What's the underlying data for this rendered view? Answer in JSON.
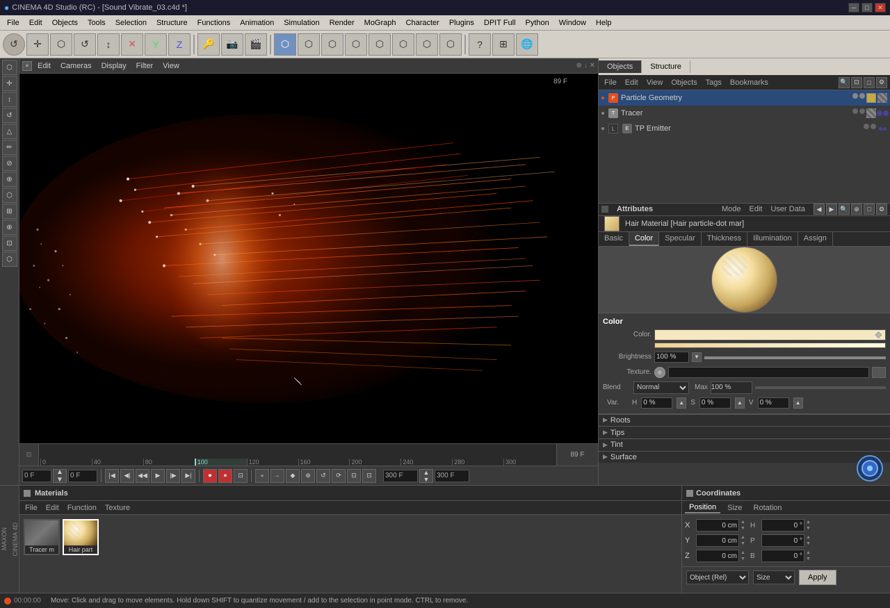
{
  "titleBar": {
    "title": "CINEMA 4D Studio (RC) - [Sound Vibrate_03.c4d *]",
    "winBtns": [
      "─",
      "□",
      "✕"
    ]
  },
  "menuBar": {
    "items": [
      "File",
      "Edit",
      "Objects",
      "Tools",
      "Selection",
      "Structure",
      "Functions",
      "Animation",
      "Simulation",
      "Render",
      "MoGraph",
      "Character",
      "Plugins",
      "DPIT Full",
      "Python",
      "Window",
      "Help"
    ]
  },
  "toolbar": {
    "buttons": [
      "⬤",
      "✛",
      "⬡",
      "↺",
      "↕",
      "✕",
      "Y",
      "Z",
      "→",
      "🎬",
      "📷",
      "🎞",
      "⬡",
      "⬡",
      "⬡",
      "⬡",
      "⬡",
      "⬡",
      "⬡",
      "⬡",
      "⬡",
      "?",
      "⬡",
      "🌐"
    ]
  },
  "viewport": {
    "menuItems": [
      "Edit",
      "Cameras",
      "Display",
      "Filter",
      "View"
    ],
    "frameInfo": "89 F",
    "cursorPos": "~385, ~360"
  },
  "timeline": {
    "marks": [
      "0",
      "40",
      "80",
      "100",
      "120",
      "160",
      "200",
      "240",
      "280",
      "300"
    ],
    "playhead": "100",
    "currentFrame": "0 F",
    "startFrame": "0 F",
    "endFrame": "300 F",
    "previewEnd": "300 F"
  },
  "transport": {
    "currentFrame": "0 F",
    "startFrame": "0 F",
    "endFrame": "300 F",
    "previewEnd": "300 F"
  },
  "rightPanel": {
    "tabs": [
      "Objects",
      "Structure"
    ],
    "objectsMenuItems": [
      "File",
      "Edit",
      "View",
      "Objects",
      "Tags",
      "Bookmarks"
    ],
    "objects": [
      {
        "name": "Particle Geometry",
        "type": "particle",
        "color": "#e05020",
        "selected": true
      },
      {
        "name": "Tracer",
        "type": "tracer",
        "color": "#888"
      },
      {
        "name": "TP Emitter",
        "type": "emitter",
        "color": "#888"
      }
    ]
  },
  "attrsPanel": {
    "menuItems": [
      "Mode",
      "Edit",
      "User Data"
    ],
    "materialName": "Hair Material [Hair particle-dot mar]",
    "tabs": [
      "Basic",
      "Color",
      "Specular",
      "Thickness",
      "Illumination",
      "Assign"
    ],
    "activeTab": "Color",
    "colorSection": {
      "title": "Color",
      "colorLabel": "Color.",
      "colorValue": "#f5e8c0",
      "brightnessLabel": "Brightness",
      "brightnessValue": "100 %",
      "textureLabel": "Texture.",
      "blendLabel": "Blend",
      "blendMode": "Normal",
      "blendMax": "Max  100 %",
      "varLabel": "Var.",
      "varH": "H  0 %",
      "varS": "S  0 %",
      "varV": "V  0 %"
    },
    "collapseSections": [
      "Roots",
      "Tips",
      "Tint",
      "Surface"
    ]
  },
  "materialsPanel": {
    "title": "Materials",
    "menuItems": [
      "File",
      "Edit",
      "Function",
      "Texture"
    ],
    "materials": [
      {
        "name": "Tracer m",
        "type": "tracer",
        "color1": "#888",
        "color2": "#555"
      },
      {
        "name": "Hair part",
        "type": "hair",
        "color1": "#f5dfa0",
        "color2": "#c8a860"
      }
    ]
  },
  "coordsPanel": {
    "title": "Coordinates",
    "subtabs": [
      "Position",
      "Size",
      "Rotation"
    ],
    "position": {
      "X": "0 cm",
      "Y": "0 cm",
      "Z": "0 cm"
    },
    "size": {
      "H": "0 °",
      "P": "0 °",
      "B": "0 °"
    },
    "size2": {
      "X": "0 cm",
      "Y": "0 cm",
      "Z": "0 cm"
    },
    "objectType": "Object (Rel)",
    "sizeMode": "Size",
    "applyLabel": "Apply"
  },
  "statusBar": {
    "time": "00:00:00",
    "message": "Move: Click and drag to move elements. Hold down SHIFT to quantize movement / add to the selection in point mode. CTRL to remove."
  }
}
